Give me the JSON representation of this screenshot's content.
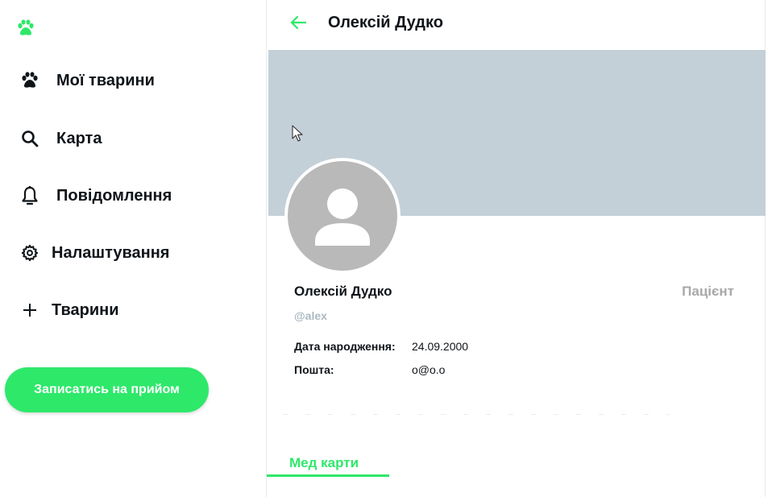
{
  "colors": {
    "accent": "#2ee86a",
    "banner": "#c4d0d8",
    "avatar_bg": "#b9b9b9",
    "muted": "#a8a8a8"
  },
  "sidebar": {
    "logo_icon": "paw-icon",
    "items": [
      {
        "label": "Мої тварини",
        "icon": "paw-icon"
      },
      {
        "label": "Карта",
        "icon": "search-icon"
      },
      {
        "label": "Повідомлення",
        "icon": "bell-icon"
      },
      {
        "label": "Налаштування",
        "icon": "gear-icon"
      },
      {
        "label": "Тварини",
        "icon": "plus-icon"
      }
    ],
    "cta_label": "Записатись на прийом"
  },
  "profile": {
    "header_title": "Олексій Дудко",
    "back_icon": "arrow-left-icon",
    "name": "Олексій Дудко",
    "role": "Пацієнт",
    "handle": "@alex",
    "fields": [
      {
        "label": "Дата народження:",
        "value": "24.09.2000"
      },
      {
        "label": "Пошта:",
        "value": "o@o.o"
      }
    ],
    "tab_label": "Мед карти"
  }
}
